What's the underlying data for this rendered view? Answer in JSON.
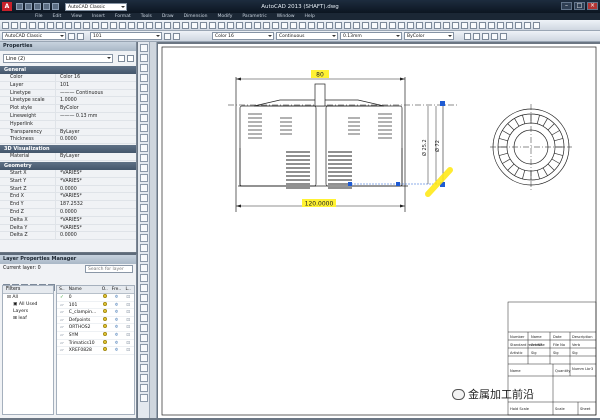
{
  "titlebar": {
    "title": "AutoCAD 2013  (SHAFT).dwg",
    "workspace": "AutoCAD Classic"
  },
  "menubar": [
    "File",
    "Edit",
    "View",
    "Insert",
    "Format",
    "Tools",
    "Draw",
    "Dimension",
    "Modify",
    "Parametric",
    "Window",
    "Help"
  ],
  "toolbar2": {
    "workspace": "AutoCAD Classic",
    "layer": "101",
    "color": "Color 16",
    "linetype": "Continuous",
    "lineweight": "0.13mm",
    "plotstyle": "ByColor"
  },
  "properties": {
    "title": "Properties",
    "selection": "Line (2)",
    "sections": {
      "general": "General",
      "viz": "3D Visualization",
      "geometry": "Geometry"
    },
    "general_rows": [
      {
        "k": "Color",
        "v": "Color 16"
      },
      {
        "k": "Layer",
        "v": "101"
      },
      {
        "k": "Linetype",
        "v": "——— Continuous"
      },
      {
        "k": "Linetype scale",
        "v": "1.0000"
      },
      {
        "k": "Plot style",
        "v": "ByColor"
      },
      {
        "k": "Lineweight",
        "v": "——— 0.13 mm"
      },
      {
        "k": "Hyperlink",
        "v": ""
      },
      {
        "k": "Transparency",
        "v": "ByLayer"
      },
      {
        "k": "Thickness",
        "v": "0.0000"
      }
    ],
    "viz_rows": [
      {
        "k": "Material",
        "v": "ByLayer"
      }
    ],
    "geometry_rows": [
      {
        "k": "Start X",
        "v": "*VARIES*"
      },
      {
        "k": "Start Y",
        "v": "*VARIES*"
      },
      {
        "k": "Start Z",
        "v": "0.0000"
      },
      {
        "k": "End X",
        "v": "*VARIES*"
      },
      {
        "k": "End Y",
        "v": "187.2532"
      },
      {
        "k": "End Z",
        "v": "0.0000"
      },
      {
        "k": "Delta X",
        "v": "*VARIES*"
      },
      {
        "k": "Delta Y",
        "v": "*VARIES*"
      },
      {
        "k": "Delta Z",
        "v": "0.0000"
      }
    ]
  },
  "layers": {
    "title": "Layer Properties Manager",
    "current": "Current layer: 0",
    "search_placeholder": "Search for layer",
    "filters_header": "Filters",
    "filters": [
      "All",
      "All Used Layers",
      "leaf"
    ],
    "columns": [
      "S..",
      "Name",
      "O..",
      "Fre..",
      "L.."
    ],
    "rows": [
      {
        "name": "0",
        "current": true
      },
      {
        "name": "101"
      },
      {
        "name": "C_clampin..."
      },
      {
        "name": "Defpoints"
      },
      {
        "name": "ORTHOS2"
      },
      {
        "name": "SYM"
      },
      {
        "name": "Trimatics10"
      },
      {
        "name": "XREF0828"
      }
    ]
  },
  "drawing": {
    "dim_top": "80",
    "dim_bottom": "120.0000",
    "dim_d1": "Ø 25.2",
    "dim_d2": "Ø 72"
  },
  "titleblock": {
    "row1": [
      "Number",
      "Name",
      "Date",
      "Description"
    ],
    "row2": [
      "Standard reference",
      "Art.NR",
      "File No",
      "Verb"
    ],
    "row3": [
      "Artistic",
      "Sig",
      "Sig",
      "Sig"
    ],
    "items": [
      "Name",
      "Quantity"
    ],
    "bottom": [
      "Hold Scale",
      "Scale",
      "Sheet"
    ],
    "part": "Numm Lbr3"
  },
  "watermark": {
    "text": "金属加工前沿"
  }
}
